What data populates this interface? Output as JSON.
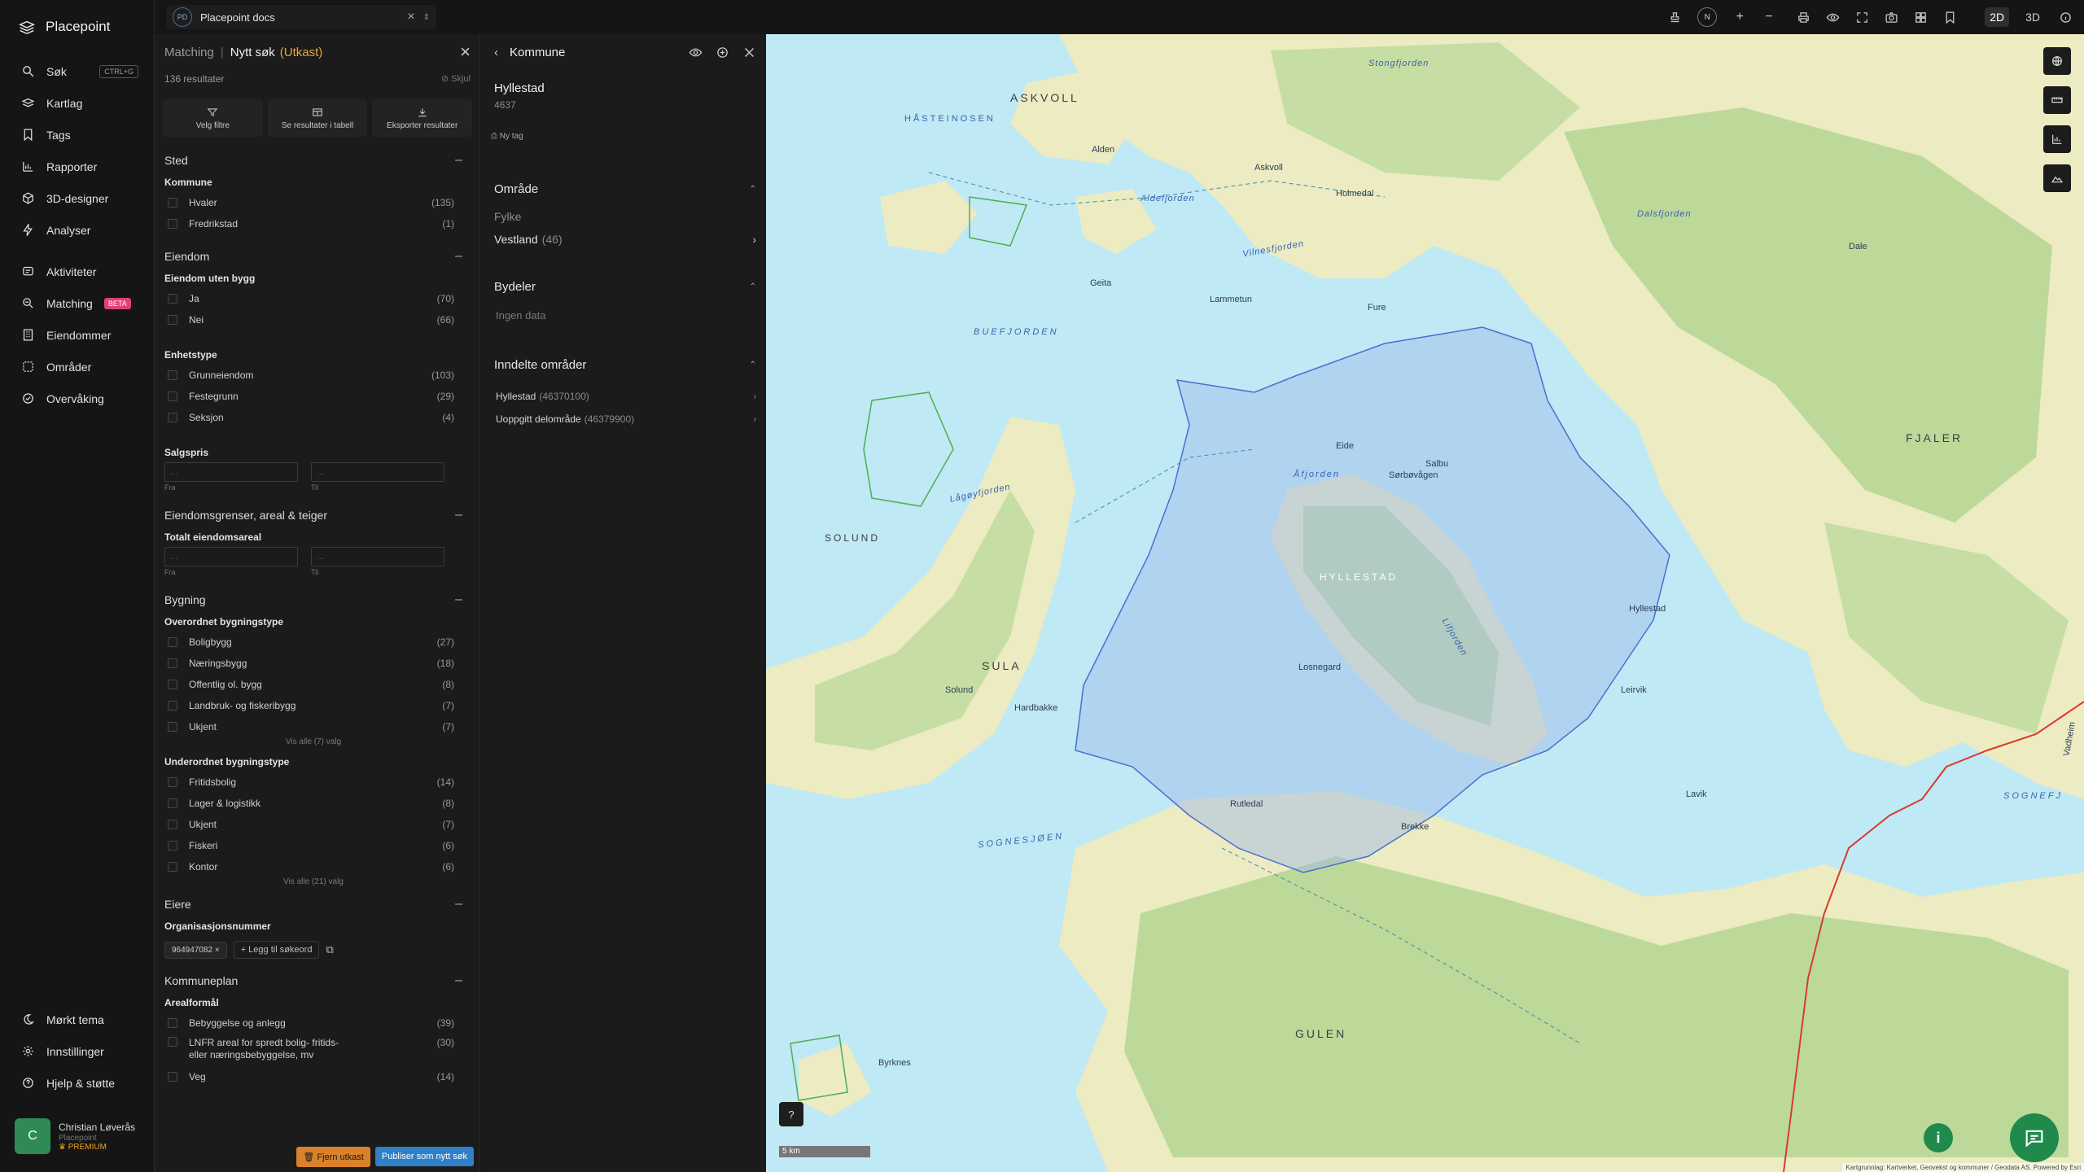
{
  "nav": {
    "brand": "Placepoint",
    "items": [
      {
        "label": "Søk",
        "icon": "search-icon",
        "kbd": "CTRL+G"
      },
      {
        "label": "Kartlag",
        "icon": "layers-icon"
      },
      {
        "label": "Tags",
        "icon": "bookmark-icon"
      },
      {
        "label": "Rapporter",
        "icon": "chart-icon"
      },
      {
        "label": "3D-designer",
        "icon": "cube-icon"
      },
      {
        "label": "Analyser",
        "icon": "bolt-icon"
      },
      {
        "label": "Aktiviteter",
        "icon": "activity-icon"
      },
      {
        "label": "Matching",
        "icon": "target-icon",
        "badge": "BETA"
      },
      {
        "label": "Eiendommer",
        "icon": "building-icon"
      },
      {
        "label": "Områder",
        "icon": "area-icon"
      },
      {
        "label": "Overvåking",
        "icon": "check-circle-icon"
      }
    ],
    "bottom": [
      {
        "label": "Mørkt tema",
        "icon": "moon-icon"
      },
      {
        "label": "Innstillinger",
        "icon": "gear-icon"
      },
      {
        "label": "Hjelp & støtte",
        "icon": "help-icon"
      }
    ],
    "user": {
      "initial": "C",
      "name": "Christian Løverås",
      "org": "Placepoint",
      "plan": "PREMIUM"
    }
  },
  "topbar": {
    "doc_badge": "PD",
    "doc_title": "Placepoint docs",
    "north": "N",
    "mode_2d": "2D",
    "mode_3d": "3D"
  },
  "search": {
    "crumb": "Matching",
    "title": "Nytt søk",
    "status": "(Utkast)",
    "results": "136 resultater",
    "hide": "Skjul",
    "actions": [
      "Velg filtre",
      "Se resultater i tabell",
      "Eksporter resultater"
    ],
    "from": "Fra",
    "to": "Til",
    "sections": {
      "sted": {
        "title": "Sted",
        "kommune": "Kommune",
        "options": [
          [
            "Hvaler",
            "(135)"
          ],
          [
            "Fredrikstad",
            "(1)"
          ]
        ]
      },
      "eiendom": {
        "title": "Eiendom",
        "utenbygg": "Eiendom uten bygg",
        "opts1": [
          [
            "Ja",
            "(70)"
          ],
          [
            "Nei",
            "(66)"
          ]
        ],
        "enhetstype": "Enhetstype",
        "opts2": [
          [
            "Grunneiendom",
            "(103)"
          ],
          [
            "Festegrunn",
            "(29)"
          ],
          [
            "Seksjon",
            "(4)"
          ]
        ],
        "salgspris": "Salgspris"
      },
      "grenser": {
        "title": "Eiendomsgrenser, areal & teiger",
        "areal": "Totalt eiendomsareal"
      },
      "bygning": {
        "title": "Bygning",
        "overordnet": "Overordnet bygningstype",
        "opts1": [
          [
            "Boligbygg",
            "(27)"
          ],
          [
            "Næringsbygg",
            "(18)"
          ],
          [
            "Offentlig ol. bygg",
            "(8)"
          ],
          [
            "Landbruk- og fiskeribygg",
            "(7)"
          ],
          [
            "Ukjent",
            "(7)"
          ]
        ],
        "more1": "Vis alle (7) valg",
        "underordnet": "Underordnet bygningstype",
        "opts2": [
          [
            "Fritidsbolig",
            "(14)"
          ],
          [
            "Lager & logistikk",
            "(8)"
          ],
          [
            "Ukjent",
            "(7)"
          ],
          [
            "Fiskeri",
            "(6)"
          ],
          [
            "Kontor",
            "(6)"
          ]
        ],
        "more2": "Vis alle (21) valg"
      },
      "eiere": {
        "title": "Eiere",
        "org": "Organisasjonsnummer",
        "chip": "964947082",
        "add": "Legg til søkeord"
      },
      "kommuneplan": {
        "title": "Kommuneplan",
        "arealformal": "Arealformål",
        "opts": [
          [
            "Bebyggelse og anlegg",
            "(39)"
          ],
          [
            "LNFR areal for spredt bolig- fritids- eller næringsbebyggelse, mv",
            "(30)"
          ],
          [
            "Veg",
            "(14)"
          ]
        ]
      }
    },
    "footer": {
      "remove": "Fjern utkast",
      "publish": "Publiser som nytt søk"
    }
  },
  "detail": {
    "header": "Kommune",
    "name": "Hyllestad",
    "code": "4637",
    "newtag": "Ny tag",
    "omrade": "Område",
    "fylke_label": "Fylke",
    "fylke_value": "Vestland",
    "fylke_count": "(46)",
    "bydeler": "Bydeler",
    "nodata": "Ingen data",
    "inndelte": "Inndelte områder",
    "subareas": [
      [
        "Hyllestad",
        "(46370100)"
      ],
      [
        "Uoppgitt delområde",
        "(46379900)"
      ]
    ]
  },
  "map": {
    "labels": {
      "buefjorden": "BUEFJORDEN",
      "sognesjoen": "SOGNESJØEN",
      "sognefj": "SOGNEFJ",
      "sula": "SULA",
      "gulen": "GULEN",
      "fjaler": "FJALER",
      "askvoll": "ASKVOLL",
      "solund": "SOLUND",
      "hyllestad": "HYLLESTAD",
      "hasteinosen": "HÅSTEINOSEN",
      "atjorden": "Åfjorden",
      "lagoyfjorden": "Lågøyfjorden",
      "vilnesfjorden": "Vilnesfjorden",
      "aldefjorden": "Aldefjorden",
      "lifjorden": "Lifjorden",
      "dalsfjorden": "Dalsfjorden",
      "stongfjorden": "Stongfjorden",
      "geita": "Geita",
      "alden": "Alden",
      "hyllestad_town": "Hyllestad",
      "leirvik": "Leirvik",
      "losnegard": "Losnegard",
      "solund_town": "Solund",
      "lavik": "Lavik",
      "brekke": "Brekke",
      "dale": "Dale",
      "fure": "Fure",
      "askvoll_town": "Askvoll",
      "holmedal": "Holmedal",
      "rutledal": "Rutledal",
      "byrknes": "Byrknes",
      "lammetun": "Lammetun",
      "eide": "Eide",
      "salbu": "Salbu",
      "sorbovagen": "Sørbøvågen",
      "hardbakke": "Hardbakke",
      "vadheim": "Vadheim"
    },
    "scale": "5 km",
    "attribution": "Kartgrunnlag: Kartverket, Geovekst og kommuner / Geodata AS. Powered by Esri",
    "colors": {
      "sea": "#bfe9f4",
      "land": "#ecebc2",
      "forest": "#bcd99a",
      "selection": "#9db8ea"
    }
  }
}
